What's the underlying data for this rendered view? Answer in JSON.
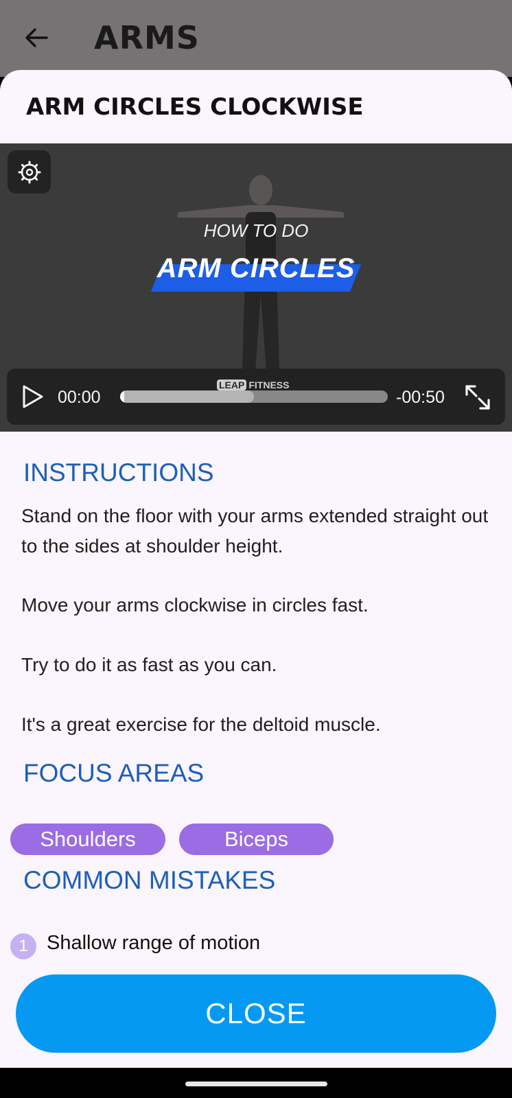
{
  "appbar": {
    "title": "ARMS"
  },
  "exercise": {
    "title": "ARM CIRCLES CLOCKWISE"
  },
  "video": {
    "overlay_line1": "HOW TO DO",
    "overlay_line2": "ARM CIRCLES",
    "watermark_box": "LEAP",
    "watermark_text": "FITNESS",
    "time_current": "00:00",
    "time_remaining": "-00:50",
    "progress_fraction": 0.0,
    "buffered_fraction": 0.5
  },
  "instructions": {
    "heading": "INSTRUCTIONS",
    "paragraphs": [
      "Stand on the floor with your arms extended straight out to the sides at shoulder height.",
      "Move your arms clockwise in circles fast.",
      "Try to do it as fast as you can.",
      "It's a great exercise for the deltoid muscle."
    ]
  },
  "focus": {
    "heading": "FOCUS AREAS",
    "areas": [
      "Shoulders",
      "Biceps"
    ]
  },
  "mistakes": {
    "heading": "COMMON MISTAKES",
    "items": [
      {
        "number": "1",
        "text": "Shallow range of motion"
      }
    ]
  },
  "close_label": "CLOSE",
  "colors": {
    "accent_blue": "#1c5fb8",
    "chip_purple": "#9b6ce4",
    "close_button": "#0599f2"
  }
}
